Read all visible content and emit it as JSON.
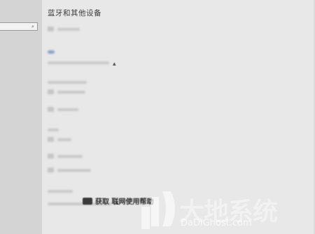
{
  "page": {
    "title": "蓝牙和其他设备"
  },
  "sidebar": {
    "search_icon": "search-icon"
  },
  "footer": {
    "link_text": "获取 联网使用帮助"
  },
  "watermark": {
    "cn": "大地系统",
    "en": "DaDiGhost.com"
  },
  "colors": {
    "toggle_on": "#8fa3c7",
    "sidebar_bg": "#d4d4d4",
    "main_bg": "#e8e8e8"
  }
}
